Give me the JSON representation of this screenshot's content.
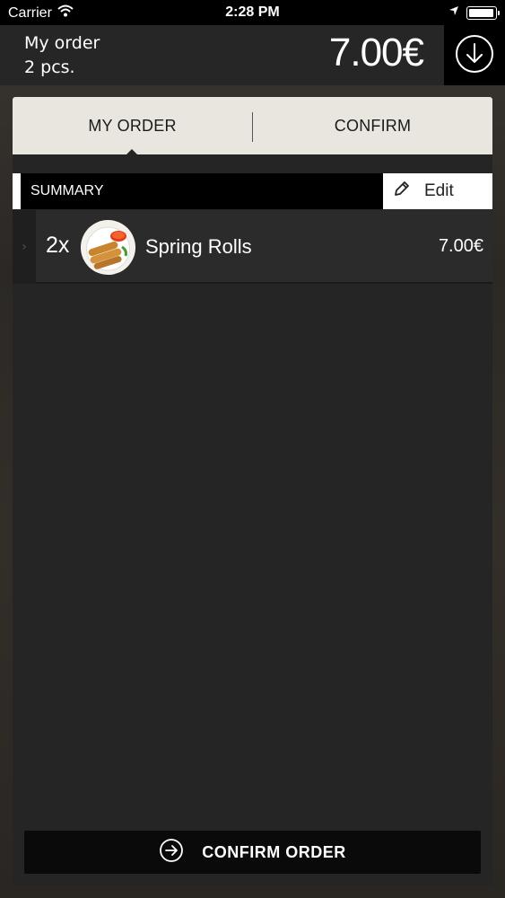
{
  "status_bar": {
    "carrier": "Carrier",
    "time": "2:28 PM",
    "battery_level": 1.0
  },
  "order_header": {
    "title": "My order",
    "count": "2 pcs.",
    "total": "7.00€",
    "download_icon": "arrow-down-circle-icon"
  },
  "tabs": [
    {
      "label": "MY ORDER",
      "active": true
    },
    {
      "label": "CONFIRM",
      "active": false
    }
  ],
  "summary": {
    "label": "SUMMARY",
    "edit_label": "Edit",
    "edit_icon": "pencil-icon"
  },
  "items": [
    {
      "qty": "2x",
      "name": "Spring Rolls",
      "price": "7.00€",
      "image": "spring-rolls-thumbnail"
    }
  ],
  "confirm_button": {
    "label": "CONFIRM ORDER",
    "icon": "arrow-right-circle-icon"
  },
  "colors": {
    "tab_bar": "#e9e6df",
    "panel": "#252525",
    "header": "#262626"
  }
}
